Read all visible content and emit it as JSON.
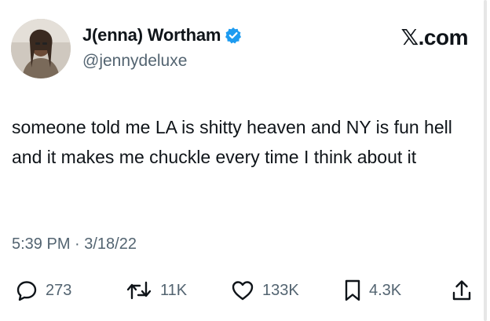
{
  "author": {
    "display_name": "J(enna) Wortham",
    "handle": "@jennydeluxe",
    "verified": true,
    "avatar": "profile-photo"
  },
  "brand": {
    "label": "𝕏.com"
  },
  "tweet": {
    "text": "someone told me LA is shitty heaven and NY is fun hell and it makes me chuckle every time I think about it",
    "timestamp": "5:39 PM · 3/18/22"
  },
  "actions": {
    "replies": {
      "icon": "reply-icon",
      "count": "273"
    },
    "retweets": {
      "icon": "retweet-icon",
      "count": "11K"
    },
    "likes": {
      "icon": "heart-icon",
      "count": "133K"
    },
    "bookmarks": {
      "icon": "bookmark-icon",
      "count": "4.3K"
    },
    "share": {
      "icon": "share-icon"
    }
  },
  "colors": {
    "verified_blue": "#1d9bf0",
    "text_primary": "#0f1419",
    "text_secondary": "#536471"
  }
}
